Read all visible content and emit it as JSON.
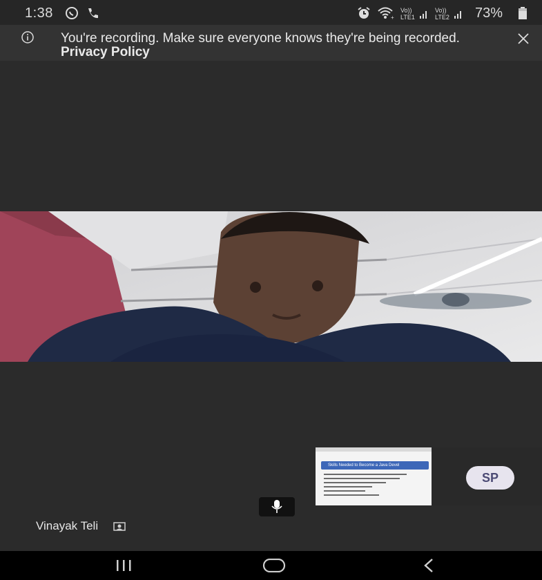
{
  "status_bar": {
    "time": "1:38",
    "battery": "73%",
    "icons": [
      "whatsapp-icon",
      "phone-icon",
      "alarm-icon",
      "wifi-icon",
      "signal-lte1-icon",
      "signal-lte2-icon",
      "battery-icon"
    ]
  },
  "banner": {
    "message": "You're recording. Make sure everyone knows they're being recorded.",
    "link": "Privacy Policy",
    "icons": [
      "info-icon",
      "close-icon"
    ]
  },
  "shared_screen": {
    "heading": "Skills Needed to Become a Java Devel"
  },
  "participant": {
    "avatar_initials": "SP"
  },
  "self_view": {
    "name": "Vinayak Teli"
  },
  "controls": {
    "icons": [
      "microphone-icon",
      "camera-off-icon"
    ]
  },
  "nav": {
    "icons": [
      "recent-apps-icon",
      "home-icon",
      "back-icon"
    ]
  },
  "colors": {
    "background": "#2b2b2b",
    "banner": "#333333",
    "avatar_bg": "#e7e4ee",
    "avatar_text": "#4b4a74"
  }
}
